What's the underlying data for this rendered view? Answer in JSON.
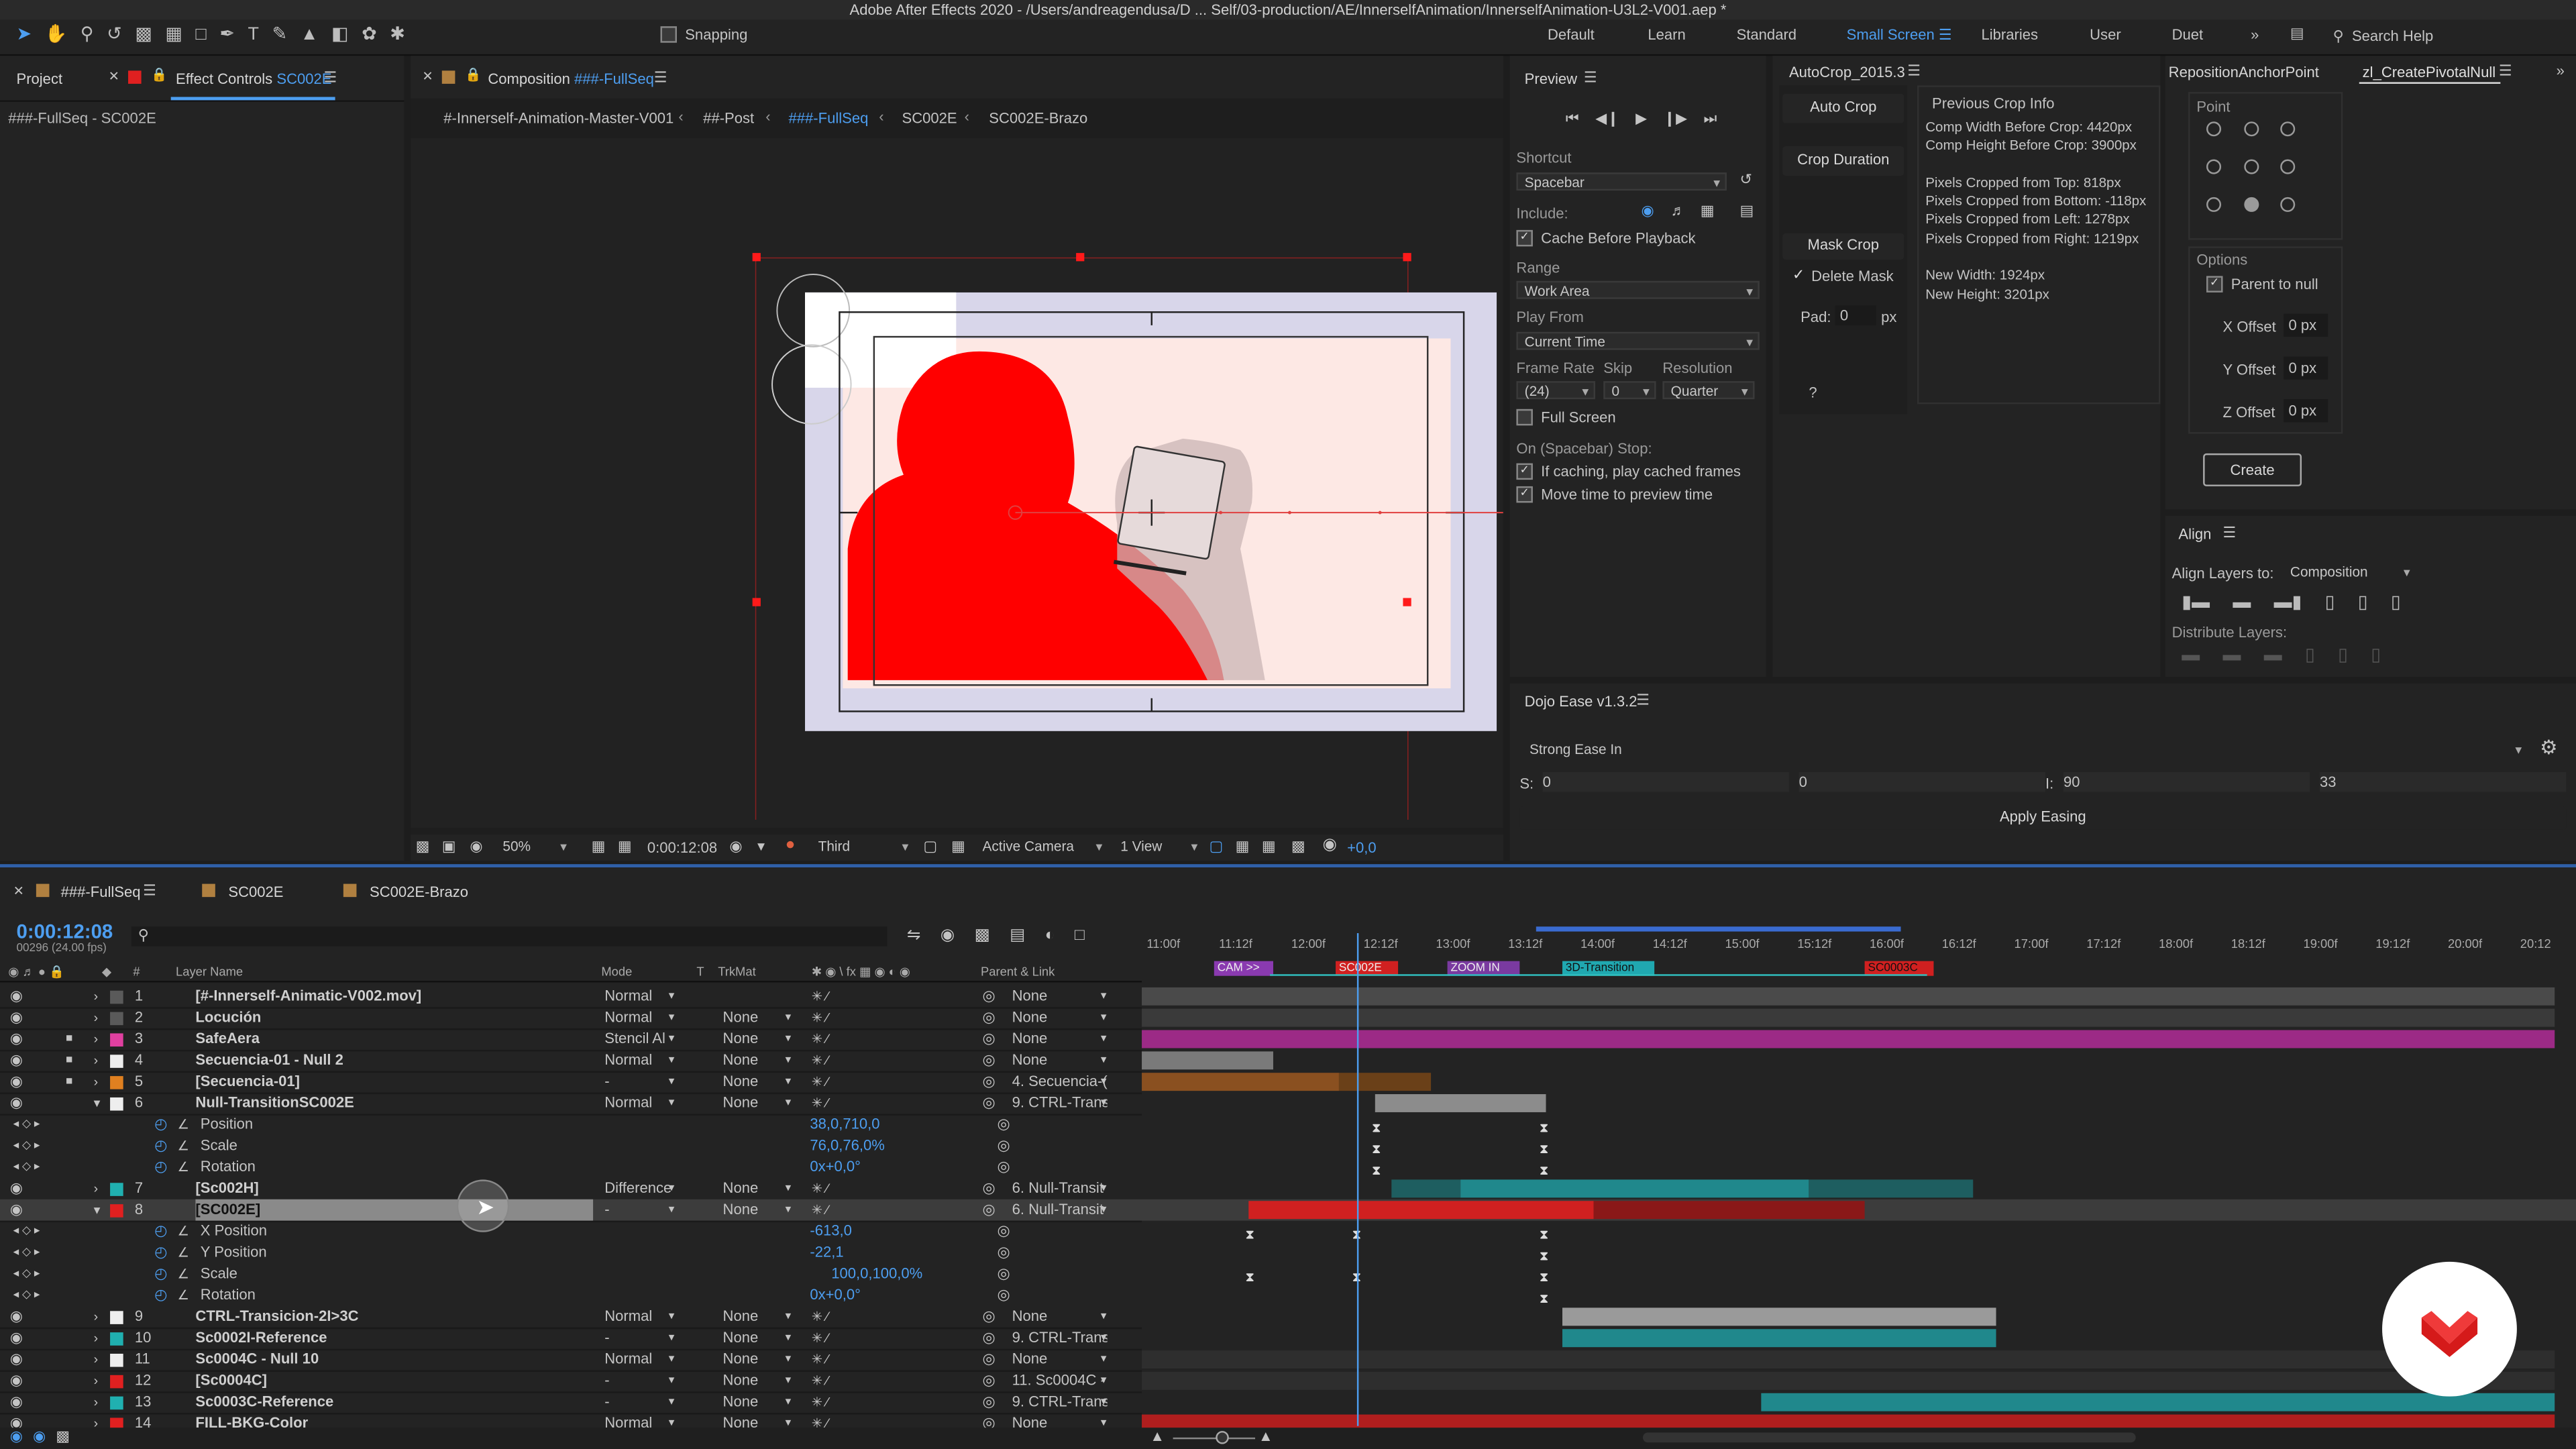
{
  "window_title": "Adobe After Effects 2020 - /Users/andreagendusa/D ... Self/03-production/AE/InnerselfAnimation/InnerselfAnimation-U3L2-V001.aep *",
  "toolbar": {
    "snapping_label": "Snapping",
    "workspaces": [
      "Default",
      "Learn",
      "Standard",
      "Small Screen",
      "Libraries",
      "User",
      "Duet"
    ],
    "active_workspace": "Small Screen",
    "more_label": "»",
    "search_placeholder": "Search Help"
  },
  "left_panel": {
    "tab_project": "Project",
    "tab_effect_controls": "Effect Controls",
    "effect_controls_target": "SC002E",
    "subtitle": "###-FullSeq - SC002E"
  },
  "composition": {
    "tab_prefix": "Composition",
    "tab_name": "###-FullSeq",
    "breadcrumbs": [
      "#-Innerself-Animation-Master-V001",
      "##-Post",
      "###-FullSeq",
      "SC002E",
      "SC002E-Brazo"
    ],
    "active_breadcrumb": "###-FullSeq",
    "footer": {
      "zoom": "50%",
      "timecode": "0:00:12:08",
      "resolution": "Third",
      "camera": "Active Camera",
      "views": "1 View",
      "exposure": "+0,0"
    }
  },
  "preview": {
    "title": "Preview",
    "shortcut_label": "Shortcut",
    "shortcut_value": "Spacebar",
    "include_label": "Include:",
    "cache_before_playback": "Cache Before Playback",
    "range_label": "Range",
    "range_value": "Work Area",
    "play_from_label": "Play From",
    "play_from_value": "Current Time",
    "frame_rate_label": "Frame Rate",
    "skip_label": "Skip",
    "resolution_label": "Resolution",
    "frame_rate_value": "(24)",
    "skip_value": "0",
    "resolution_value": "Quarter",
    "full_screen": "Full Screen",
    "on_stop_label": "On (Spacebar) Stop:",
    "if_caching": "If caching, play cached frames",
    "move_time": "Move time to preview time"
  },
  "autocrop": {
    "title": "AutoCrop_2015.3",
    "auto_crop": "Auto Crop",
    "crop_duration": "Crop Duration",
    "mask_crop": "Mask Crop",
    "delete_mask": "Delete Mask",
    "pad_label": "Pad:",
    "pad_value": "0",
    "pad_unit": "px",
    "help": "?",
    "previous_title": "Previous Crop Info",
    "info_lines": [
      "Comp Width Before Crop: 4420px",
      "Comp Height Before Crop: 3900px",
      "",
      "Pixels Cropped from Top: 818px",
      "Pixels Cropped from Bottom: -118px",
      "Pixels Cropped from Left: 1278px",
      "Pixels Cropped from Right: 1219px",
      "",
      "New Width: 1924px",
      "New Height: 3201px"
    ]
  },
  "reposition": {
    "tab1": "RepositionAnchorPoint",
    "tab2": "zl_CreatePivotalNull",
    "point_label": "Point",
    "options_label": "Options",
    "parent_to_null": "Parent to null",
    "x_offset_label": "X Offset",
    "y_offset_label": "Y Offset",
    "z_offset_label": "Z Offset",
    "x_offset_value": "0 px",
    "y_offset_value": "0 px",
    "z_offset_value": "0 px",
    "create": "Create"
  },
  "align": {
    "title": "Align",
    "align_layers_to_label": "Align Layers to:",
    "align_layers_to_value": "Composition",
    "distribute_label": "Distribute Layers:"
  },
  "dojo": {
    "title": "Dojo Ease v1.3.2",
    "preset": "Strong Ease In",
    "s_label": "S:",
    "s1": "0",
    "s2": "0",
    "i_label": "I:",
    "i1": "90",
    "i2": "33",
    "apply": "Apply Easing"
  },
  "timeline": {
    "tabs": [
      "###-FullSeq",
      "SC002E",
      "SC002E-Brazo"
    ],
    "current_time": "0:00:12:08",
    "frame_info": "00296 (24.00 fps)",
    "headers": {
      "num": "#",
      "layer_name": "Layer Name",
      "mode": "Mode",
      "t": "T",
      "trkmat": "TrkMat",
      "parent": "Parent & Link"
    },
    "ruler": [
      "11:00f",
      "11:12f",
      "12:00f",
      "12:12f",
      "13:00f",
      "13:12f",
      "14:00f",
      "14:12f",
      "15:00f",
      "15:12f",
      "16:00f",
      "16:12f",
      "17:00f",
      "17:12f",
      "18:00f",
      "18:12f",
      "19:00f",
      "19:12f",
      "20:00f",
      "20:12"
    ],
    "markers": [
      "CAM >>",
      "SC002E",
      "ZOOM IN",
      "3D-Transition",
      "SC0003C"
    ],
    "playhead_fraction": 0.152,
    "layers": [
      {
        "num": "1",
        "name": "[#-Innerself-Animatic-V002.mov]",
        "mode": "Normal",
        "trkmat": "",
        "parent": "None",
        "color": "#5a5a5a"
      },
      {
        "num": "2",
        "name": "Locución",
        "mode": "Normal",
        "trkmat": "None",
        "parent": "None",
        "color": "#5a5a5a"
      },
      {
        "num": "3",
        "name": "SafeAera",
        "mode": "Stencil Al",
        "trkmat": "None",
        "parent": "None",
        "color": "#e040a0"
      },
      {
        "num": "4",
        "name": "Secuencia-01 - Null 2",
        "mode": "Normal",
        "trkmat": "None",
        "parent": "None",
        "color": "#eeeeee"
      },
      {
        "num": "5",
        "name": "[Secuencia-01]",
        "mode": "-",
        "trkmat": "None",
        "parent": "4. Secuencia-(",
        "color": "#e08020"
      },
      {
        "num": "6",
        "name": "Null-TransitionSC002E",
        "mode": "Normal",
        "trkmat": "None",
        "parent": "9. CTRL-Trans",
        "color": "#eeeeee"
      },
      {
        "num": "7",
        "name": "[Sc002H]",
        "mode": "Difference",
        "trkmat": "None",
        "parent": "6. Null-Transit",
        "color": "#20b0b0"
      },
      {
        "num": "8",
        "name": "[SC002E]",
        "mode": "-",
        "trkmat": "None",
        "parent": "6. Null-Transit",
        "color": "#e02020"
      },
      {
        "num": "9",
        "name": "CTRL-Transicion-2I>3C",
        "mode": "Normal",
        "trkmat": "None",
        "parent": "None",
        "color": "#eeeeee"
      },
      {
        "num": "10",
        "name": "Sc0002I-Reference",
        "mode": "-",
        "trkmat": "None",
        "parent": "9. CTRL-Trans",
        "color": "#20b0b0"
      },
      {
        "num": "11",
        "name": "Sc0004C - Null 10",
        "mode": "Normal",
        "trkmat": "None",
        "parent": "None",
        "color": "#eeeeee"
      },
      {
        "num": "12",
        "name": "[Sc0004C]",
        "mode": "-",
        "trkmat": "None",
        "parent": "11. Sc0004C -",
        "color": "#e02020"
      },
      {
        "num": "13",
        "name": "Sc0003C-Reference",
        "mode": "-",
        "trkmat": "None",
        "parent": "9. CTRL-Trans",
        "color": "#20b0b0"
      },
      {
        "num": "14",
        "name": "FILL-BKG-Color",
        "mode": "Normal",
        "trkmat": "None",
        "parent": "None",
        "color": "#e02020"
      }
    ],
    "layer6_props": [
      {
        "name": "Position",
        "value": "38,0,710,0"
      },
      {
        "name": "Scale",
        "value": "76,0,76,0%"
      },
      {
        "name": "Rotation",
        "value": "0x+0,0°"
      }
    ],
    "layer8_props": [
      {
        "name": "X Position",
        "value": "-613,0"
      },
      {
        "name": "Y Position",
        "value": "-22,1"
      },
      {
        "name": "Scale",
        "value": "100,0,100,0%"
      },
      {
        "name": "Rotation",
        "value": "0x+0,0°"
      }
    ]
  }
}
